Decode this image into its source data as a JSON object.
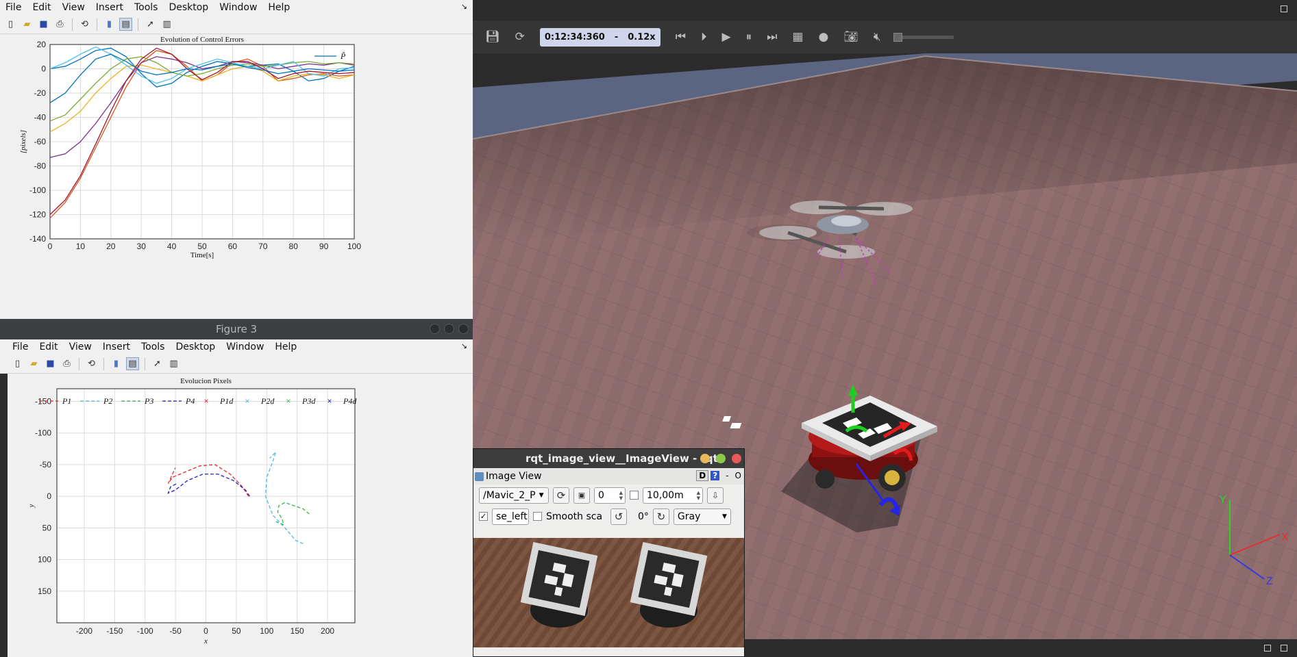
{
  "fig2": {
    "menu": [
      "File",
      "Edit",
      "View",
      "Insert",
      "Tools",
      "Desktop",
      "Window",
      "Help"
    ],
    "undock": "↘",
    "chart_data": {
      "type": "line",
      "title": "Evolution of Control Errors",
      "xlabel": "Time[s]",
      "ylabel": "[pixels]",
      "xlim": [
        0,
        100
      ],
      "ylim": [
        -140,
        20
      ],
      "xticks": [
        "0",
        "10",
        "20",
        "30",
        "40",
        "50",
        "60",
        "70",
        "80",
        "90",
        "100"
      ],
      "yticks": [
        "20",
        "0",
        "-20",
        "-40",
        "-60",
        "-80",
        "-100",
        "-120",
        "-140"
      ],
      "legend": "P̃",
      "legend_position": "top-right",
      "grid": true,
      "x": [
        0,
        5,
        10,
        15,
        20,
        25,
        30,
        35,
        40,
        45,
        50,
        55,
        60,
        65,
        70,
        75,
        80,
        85,
        90,
        95,
        100
      ],
      "series": [
        {
          "color": "#0072bd",
          "values": [
            0,
            2,
            8,
            15,
            17,
            10,
            -4,
            -15,
            -12,
            -3,
            2,
            6,
            4,
            2,
            3,
            4,
            -2,
            -10,
            -8,
            -2,
            2
          ]
        },
        {
          "color": "#d95319",
          "values": [
            -123,
            -110,
            -90,
            -65,
            -40,
            -15,
            5,
            15,
            12,
            2,
            -10,
            -5,
            5,
            8,
            2,
            -10,
            -8,
            -5,
            -4,
            -6,
            -5
          ]
        },
        {
          "color": "#edb120",
          "values": [
            -52,
            -45,
            -35,
            -20,
            -8,
            2,
            3,
            0,
            -3,
            -6,
            -10,
            -5,
            0,
            2,
            -2,
            -10,
            -6,
            -4,
            -5,
            -8,
            -5
          ]
        },
        {
          "color": "#7e2f8e",
          "values": [
            -73,
            -70,
            -60,
            -45,
            -28,
            -10,
            5,
            10,
            8,
            5,
            0,
            2,
            6,
            5,
            3,
            0,
            2,
            4,
            3,
            5,
            3
          ]
        },
        {
          "color": "#77ac30",
          "values": [
            -43,
            -38,
            -25,
            -12,
            0,
            8,
            10,
            5,
            -3,
            -6,
            -4,
            0,
            3,
            4,
            2,
            3,
            5,
            6,
            4,
            5,
            4
          ]
        },
        {
          "color": "#4dbeee",
          "values": [
            0,
            5,
            12,
            18,
            12,
            3,
            -6,
            -12,
            -8,
            0,
            4,
            8,
            5,
            2,
            0,
            3,
            6,
            -4,
            -6,
            0,
            1
          ]
        },
        {
          "color": "#a2142f",
          "values": [
            -120,
            -108,
            -88,
            -62,
            -35,
            -10,
            8,
            17,
            12,
            0,
            -9,
            -3,
            6,
            6,
            0,
            -8,
            -4,
            -2,
            -3,
            -4,
            -3
          ]
        },
        {
          "color": "#0072bd",
          "values": [
            -28,
            -20,
            -5,
            8,
            12,
            6,
            -2,
            -5,
            -3,
            0,
            -1,
            2,
            4,
            1,
            -1,
            -4,
            -2,
            0,
            -1,
            -2,
            -1
          ]
        }
      ]
    }
  },
  "fig3": {
    "title": "Figure 3",
    "menu": [
      "File",
      "Edit",
      "View",
      "Insert",
      "Tools",
      "Desktop",
      "Window",
      "Help"
    ],
    "undock": "↘",
    "chart_data": {
      "type": "scatter",
      "title": "Evolucion Pixels",
      "xlabel": "x",
      "ylabel": "y",
      "xlim": [
        -245,
        245
      ],
      "ylim": [
        -170,
        200
      ],
      "y_reversed": true,
      "xticks": [
        "-200",
        "-150",
        "-100",
        "-50",
        "0",
        "50",
        "100",
        "150",
        "200"
      ],
      "yticks": [
        "-150",
        "-100",
        "-50",
        "0",
        "50",
        "100",
        "150"
      ],
      "grid": true,
      "legend_position": "top",
      "legend": [
        {
          "label": "P1",
          "color": "#e8282c",
          "style": "dash"
        },
        {
          "label": "P2",
          "color": "#4db8e8",
          "style": "dash"
        },
        {
          "label": "P3",
          "color": "#3cb44b",
          "style": "dash"
        },
        {
          "label": "P4",
          "color": "#2020c0",
          "style": "dash"
        },
        {
          "label": "P1d",
          "color": "#e8282c",
          "style": "x"
        },
        {
          "label": "P2d",
          "color": "#4db8e8",
          "style": "x"
        },
        {
          "label": "P3d",
          "color": "#3cb44b",
          "style": "x"
        },
        {
          "label": "P4d",
          "color": "#2020c0",
          "style": "x"
        }
      ],
      "series": [
        {
          "name": "P1",
          "color": "#e8282c",
          "x": [
            70,
            60,
            40,
            15,
            -10,
            -35,
            -55,
            -62,
            -55,
            -50
          ],
          "y": [
            0,
            -15,
            -35,
            -50,
            -48,
            -38,
            -30,
            -20,
            -35,
            -45
          ]
        },
        {
          "name": "P2",
          "color": "#4db8e8",
          "x": [
            160,
            148,
            130,
            110,
            98,
            100,
            110,
            115,
            105
          ],
          "y": [
            75,
            70,
            50,
            30,
            0,
            -30,
            -55,
            -70,
            -60
          ]
        },
        {
          "name": "P3",
          "color": "#3cb44b",
          "x": [
            170,
            160,
            145,
            130,
            120,
            118,
            125,
            128,
            115
          ],
          "y": [
            28,
            20,
            15,
            10,
            15,
            25,
            35,
            45,
            40
          ]
        },
        {
          "name": "P4",
          "color": "#2020c0",
          "x": [
            72,
            65,
            45,
            20,
            -5,
            -30,
            -50,
            -62,
            -58,
            -48
          ],
          "y": [
            0,
            -10,
            -25,
            -35,
            -35,
            -25,
            -10,
            -5,
            -15,
            -20
          ]
        }
      ]
    }
  },
  "gazebo": {
    "sim_time": "0:12:34:360",
    "sep": "-",
    "rtf": "0.12x",
    "colors": {
      "floor": "#8a6a6c",
      "wall": "#5b6480"
    },
    "icons": [
      "save-icon",
      "reset-icon",
      "step-back-icon",
      "step-icon",
      "play-icon",
      "pause-icon",
      "fast-forward-icon",
      "record-icon",
      "circle-icon",
      "camera-icon",
      "mute-icon"
    ],
    "axes": {
      "x": "X",
      "y": "Y",
      "z": "Z"
    }
  },
  "rqt": {
    "title": "rqt_image_view__ImageView - rqt",
    "header": "Image View",
    "d_label": "D",
    "q_label": "?",
    "dash": "-",
    "o_label": "O",
    "topic": "/Mavic_2_P",
    "spin_value": "0",
    "range_value": "10,00m",
    "topic2": "se_left",
    "smooth_label": "Smooth sca",
    "rotation": "0°",
    "colormap": "Gray"
  }
}
